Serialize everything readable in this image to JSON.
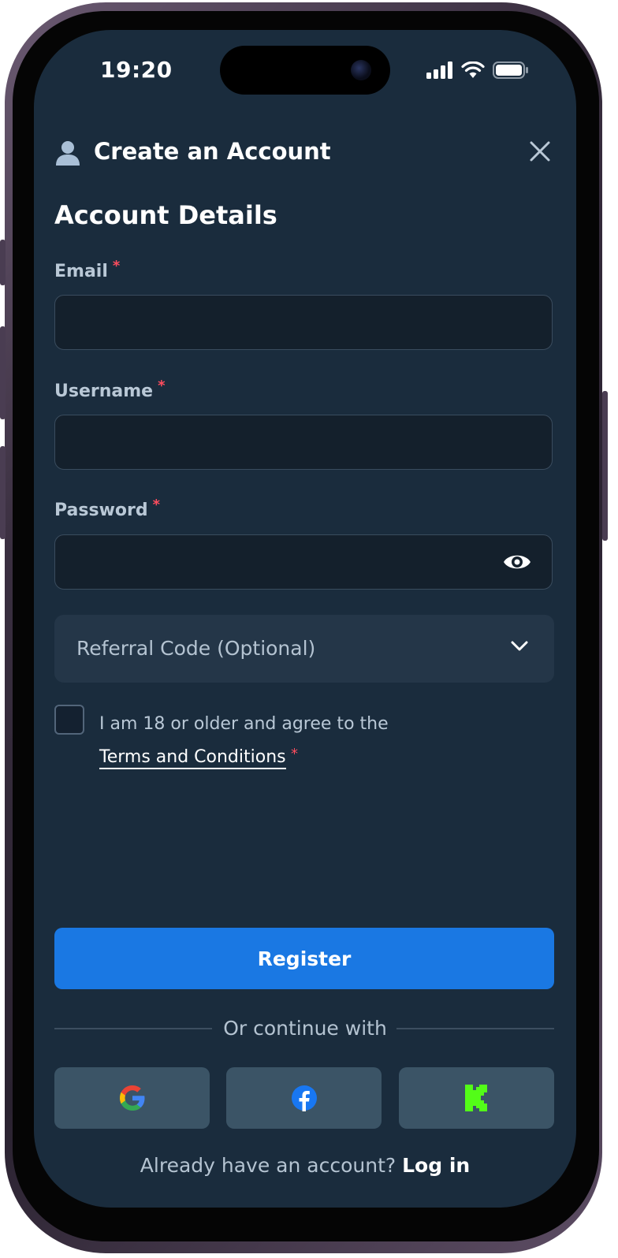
{
  "status_bar": {
    "time": "19:20"
  },
  "header": {
    "title": "Create an Account",
    "user_icon": "user-icon",
    "close_icon": "close-icon"
  },
  "form": {
    "section_title": "Account Details",
    "email": {
      "label": "Email",
      "required_mark": "*",
      "value": "",
      "placeholder": ""
    },
    "username": {
      "label": "Username",
      "required_mark": "*",
      "value": "",
      "placeholder": ""
    },
    "password": {
      "label": "Password",
      "required_mark": "*",
      "value": "",
      "placeholder": "",
      "toggle_icon": "eye-icon"
    },
    "referral": {
      "label": "Referral Code (Optional)",
      "chevron_icon": "chevron-down-icon"
    },
    "agree": {
      "text": "I am 18 or older and agree to the",
      "terms_link": "Terms and Conditions",
      "required_mark": "*",
      "checked": false
    }
  },
  "actions": {
    "register_label": "Register",
    "divider_text": "Or continue with",
    "social": [
      {
        "name": "google",
        "icon": "google-icon"
      },
      {
        "name": "facebook",
        "icon": "facebook-icon"
      },
      {
        "name": "kick",
        "icon": "kick-icon"
      }
    ],
    "login_prompt": "Already have an account?",
    "login_link": "Log in"
  },
  "colors": {
    "screen_background": "#1a2c3d",
    "input_background": "#14202c",
    "primary_button": "#1a78e3",
    "social_button": "#3b5466",
    "required_mark": "#ff4d5e",
    "label_text": "#b9c8d6"
  }
}
